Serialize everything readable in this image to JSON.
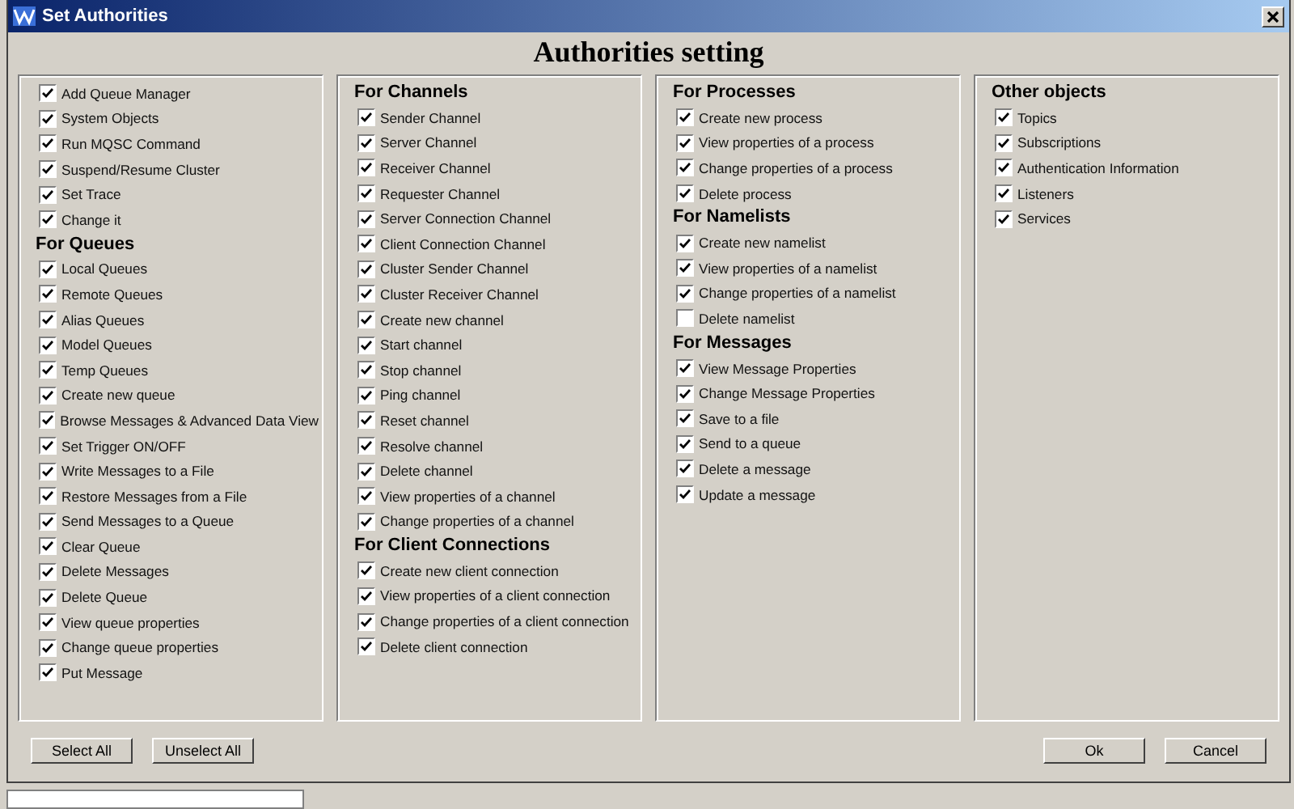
{
  "window": {
    "title": "Set Authorities"
  },
  "heading": "Authorities setting",
  "panels": [
    {
      "sections": [
        {
          "items": [
            {
              "label": "Add Queue Manager",
              "checked": true
            },
            {
              "label": "System Objects",
              "checked": true
            },
            {
              "label": "Run MQSC Command",
              "checked": true
            },
            {
              "label": "Suspend/Resume Cluster",
              "checked": true
            },
            {
              "label": "Set Trace",
              "checked": true
            },
            {
              "label": "Change it",
              "checked": true
            }
          ]
        },
        {
          "heading": "For Queues",
          "items": [
            {
              "label": "Local Queues",
              "checked": true
            },
            {
              "label": "Remote Queues",
              "checked": true
            },
            {
              "label": "Alias Queues",
              "checked": true
            },
            {
              "label": "Model Queues",
              "checked": true
            },
            {
              "label": "Temp Queues",
              "checked": true
            },
            {
              "label": "Create new queue",
              "checked": true
            },
            {
              "label": "Browse Messages & Advanced Data View",
              "checked": true
            },
            {
              "label": "Set Trigger ON/OFF",
              "checked": true
            },
            {
              "label": "Write Messages to a File",
              "checked": true
            },
            {
              "label": "Restore Messages from a File",
              "checked": true
            },
            {
              "label": "Send Messages to a Queue",
              "checked": true
            },
            {
              "label": "Clear Queue",
              "checked": true
            },
            {
              "label": "Delete Messages",
              "checked": true
            },
            {
              "label": "Delete Queue",
              "checked": true
            },
            {
              "label": "View queue properties",
              "checked": true
            },
            {
              "label": "Change queue properties",
              "checked": true
            },
            {
              "label": "Put Message",
              "checked": true
            }
          ]
        }
      ]
    },
    {
      "sections": [
        {
          "heading": "For Channels",
          "items": [
            {
              "label": "Sender Channel",
              "checked": true
            },
            {
              "label": "Server Channel",
              "checked": true
            },
            {
              "label": "Receiver Channel",
              "checked": true
            },
            {
              "label": "Requester Channel",
              "checked": true
            },
            {
              "label": "Server Connection Channel",
              "checked": true
            },
            {
              "label": "Client Connection Channel",
              "checked": true
            },
            {
              "label": "Cluster Sender Channel",
              "checked": true
            },
            {
              "label": "Cluster Receiver Channel",
              "checked": true
            },
            {
              "label": "Create new channel",
              "checked": true
            },
            {
              "label": "Start channel",
              "checked": true
            },
            {
              "label": "Stop channel",
              "checked": true
            },
            {
              "label": "Ping channel",
              "checked": true
            },
            {
              "label": "Reset channel",
              "checked": true
            },
            {
              "label": "Resolve channel",
              "checked": true
            },
            {
              "label": "Delete channel",
              "checked": true
            },
            {
              "label": "View properties of a channel",
              "checked": true
            },
            {
              "label": "Change properties of a channel",
              "checked": true
            }
          ]
        },
        {
          "heading": "For Client Connections",
          "items": [
            {
              "label": "Create new client connection",
              "checked": true
            },
            {
              "label": "View properties of a client connection",
              "checked": true
            },
            {
              "label": "Change properties of a client connection",
              "checked": true
            },
            {
              "label": "Delete client connection",
              "checked": true
            }
          ]
        }
      ]
    },
    {
      "sections": [
        {
          "heading": "For Processes",
          "items": [
            {
              "label": "Create new process",
              "checked": true
            },
            {
              "label": "View properties of a process",
              "checked": true
            },
            {
              "label": "Change properties of a process",
              "checked": true
            },
            {
              "label": "Delete process",
              "checked": true
            }
          ]
        },
        {
          "heading": "For Namelists",
          "items": [
            {
              "label": "Create new namelist",
              "checked": true
            },
            {
              "label": "View properties of a namelist",
              "checked": true
            },
            {
              "label": "Change properties of a namelist",
              "checked": true
            },
            {
              "label": "Delete namelist",
              "checked": false
            }
          ]
        },
        {
          "heading": "For Messages",
          "items": [
            {
              "label": "View Message Properties",
              "checked": true
            },
            {
              "label": "Change Message Properties",
              "checked": true
            },
            {
              "label": "Save to a file",
              "checked": true
            },
            {
              "label": "Send to a queue",
              "checked": true
            },
            {
              "label": "Delete a message",
              "checked": true
            },
            {
              "label": "Update a message",
              "checked": true
            }
          ]
        }
      ]
    },
    {
      "sections": [
        {
          "heading": "Other objects",
          "items": [
            {
              "label": "Topics",
              "checked": true
            },
            {
              "label": "Subscriptions",
              "checked": true
            },
            {
              "label": "Authentication Information",
              "checked": true
            },
            {
              "label": "Listeners",
              "checked": true
            },
            {
              "label": "Services",
              "checked": true
            }
          ]
        }
      ]
    }
  ],
  "left_buttons": [
    "Select All",
    "Unselect All"
  ],
  "right_buttons": [
    "Ok",
    "Cancel"
  ]
}
